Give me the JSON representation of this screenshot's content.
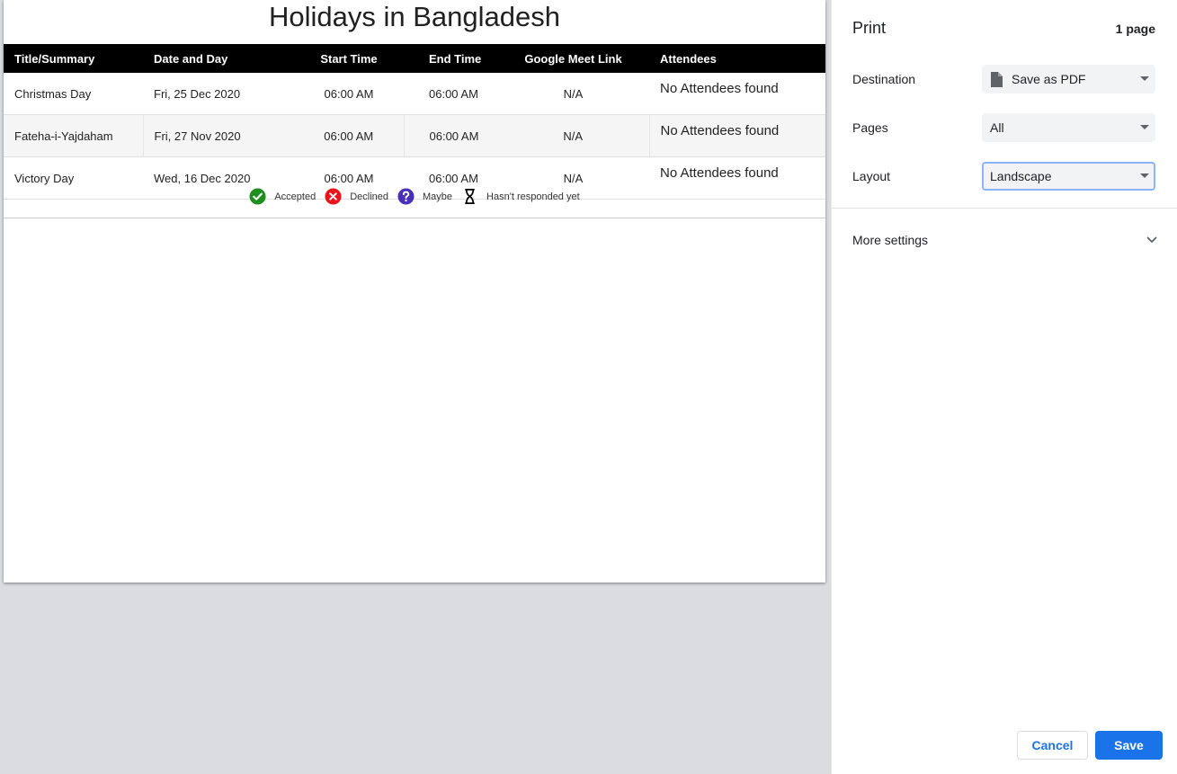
{
  "document": {
    "title": "Holidays in Bangladesh",
    "columns": [
      "Title/Summary",
      "Date and Day",
      "Start Time",
      "End Time",
      "Google Meet Link",
      "Attendees"
    ],
    "rows": [
      [
        "Christmas Day",
        "Fri, 25 Dec 2020",
        "06:00 AM",
        "06:00 AM",
        "N/A",
        "No Attendees found"
      ],
      [
        "Fateha-i-Yajdaham",
        "Fri, 27 Nov 2020",
        "06:00 AM",
        "06:00 AM",
        "N/A",
        "No Attendees found"
      ],
      [
        "Victory Day",
        "Wed, 16 Dec 2020",
        "06:00 AM",
        "06:00 AM",
        "N/A",
        "No Attendees found"
      ]
    ],
    "legend": [
      {
        "label": "Accepted",
        "icon": "check-circle-icon",
        "color": "#1e8e1e"
      },
      {
        "label": "Declined",
        "icon": "x-circle-icon",
        "color": "#e8161c"
      },
      {
        "label": "Maybe",
        "icon": "question-circle-icon",
        "color": "#4a2fb8"
      },
      {
        "label": "Hasn't responded yet",
        "icon": "hourglass-icon",
        "color": "#000000"
      }
    ]
  },
  "panel": {
    "title": "Print",
    "page_count": "1 page",
    "destination_label": "Destination",
    "destination_value": "Save as PDF",
    "pages_label": "Pages",
    "pages_value": "All",
    "layout_label": "Layout",
    "layout_value": "Landscape",
    "more_settings": "More settings",
    "cancel": "Cancel",
    "save": "Save"
  },
  "colors": {
    "accent": "#1a73e8",
    "focus_ring": "#8ab4f8",
    "preview_bg": "#dadce0"
  }
}
